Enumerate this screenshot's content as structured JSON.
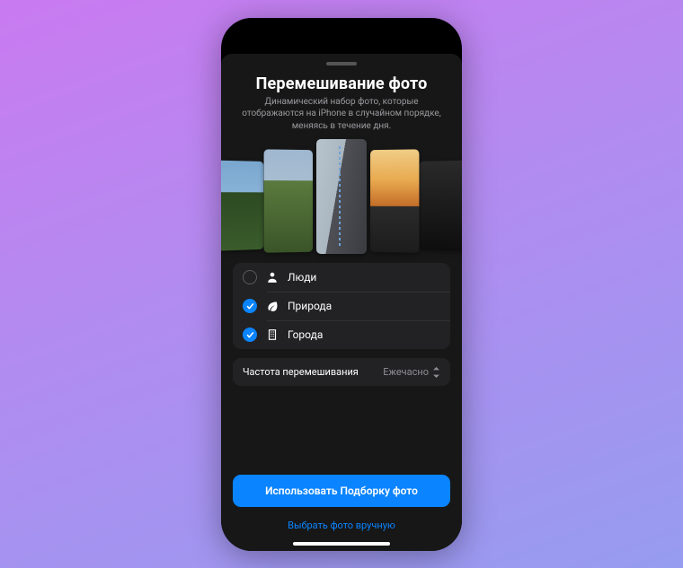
{
  "title": "Перемешивание фото",
  "subtitle": "Динамический набор фото, которые отображаются на iPhone в случайном порядке, меняясь в течение дня.",
  "options": [
    {
      "label": "Люди",
      "checked": false,
      "icon": "person"
    },
    {
      "label": "Природа",
      "checked": true,
      "icon": "leaf"
    },
    {
      "label": "Города",
      "checked": true,
      "icon": "building"
    }
  ],
  "frequency": {
    "label": "Частота перемешивания",
    "value": "Ежечасно"
  },
  "primary_button": "Использовать Подборку фото",
  "secondary_button": "Выбрать фото вручную",
  "colors": {
    "accent": "#0a84ff"
  }
}
